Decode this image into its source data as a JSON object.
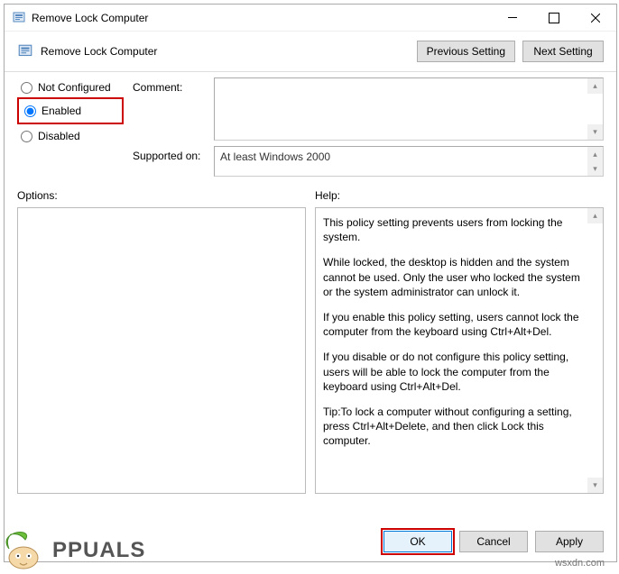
{
  "window": {
    "title": "Remove Lock Computer"
  },
  "header": {
    "title": "Remove Lock Computer",
    "prev_btn": "Previous Setting",
    "next_btn": "Next Setting"
  },
  "config": {
    "not_configured": "Not Configured",
    "enabled": "Enabled",
    "disabled": "Disabled",
    "selected": "enabled",
    "comment_label": "Comment:",
    "comment_value": "",
    "supported_label": "Supported on:",
    "supported_value": "At least Windows 2000"
  },
  "lower": {
    "options_label": "Options:",
    "help_label": "Help:",
    "help_paragraphs": [
      "This policy setting prevents users from locking the system.",
      "While locked, the desktop is hidden and the system cannot be used. Only the user who locked the system or the system administrator can unlock it.",
      "If you enable this policy setting, users cannot lock the computer from the keyboard using Ctrl+Alt+Del.",
      "If you disable or do not configure this policy setting, users will be able to lock the computer from the keyboard using Ctrl+Alt+Del.",
      "Tip:To lock a computer without configuring a setting, press Ctrl+Alt+Delete, and then click Lock this computer."
    ]
  },
  "footer": {
    "ok": "OK",
    "cancel": "Cancel",
    "apply": "Apply"
  },
  "watermark": {
    "brand": "PPUALS",
    "site": "wsxdn.com"
  }
}
